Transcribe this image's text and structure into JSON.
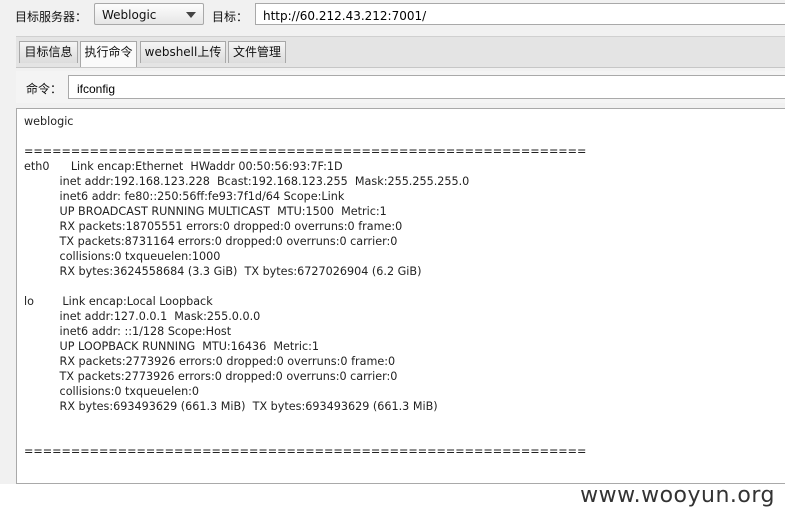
{
  "toolbar": {
    "server_label": "目标服务器：",
    "server_selected": "Weblogic",
    "target_label": "目标：",
    "target_url": "http://60.212.43.212:7001/"
  },
  "tabs": [
    {
      "label": "目标信息"
    },
    {
      "label": "执行命令"
    },
    {
      "label": "webshell上传"
    },
    {
      "label": "文件管理"
    }
  ],
  "active_tab": "执行命令",
  "command": {
    "label": "命令：",
    "value": "ifconfig"
  },
  "output": {
    "text": "weblogic\n\n============================================================\neth0      Link encap:Ethernet  HWaddr 00:50:56:93:7F:1D\n          inet addr:192.168.123.228  Bcast:192.168.123.255  Mask:255.255.255.0\n          inet6 addr: fe80::250:56ff:fe93:7f1d/64 Scope:Link\n          UP BROADCAST RUNNING MULTICAST  MTU:1500  Metric:1\n          RX packets:18705551 errors:0 dropped:0 overruns:0 frame:0\n          TX packets:8731164 errors:0 dropped:0 overruns:0 carrier:0\n          collisions:0 txqueuelen:1000\n          RX bytes:3624558684 (3.3 GiB)  TX bytes:6727026904 (6.2 GiB)\n\nlo        Link encap:Local Loopback\n          inet addr:127.0.0.1  Mask:255.0.0.0\n          inet6 addr: ::1/128 Scope:Host\n          UP LOOPBACK RUNNING  MTU:16436  Metric:1\n          RX packets:2773926 errors:0 dropped:0 overruns:0 frame:0\n          TX packets:2773926 errors:0 dropped:0 overruns:0 carrier:0\n          collisions:0 txqueuelen:0\n          RX bytes:693493629 (661.3 MiB)  TX bytes:693493629 (661.3 MiB)\n\n\n============================================================"
  },
  "watermark": "www.wooyun.org"
}
